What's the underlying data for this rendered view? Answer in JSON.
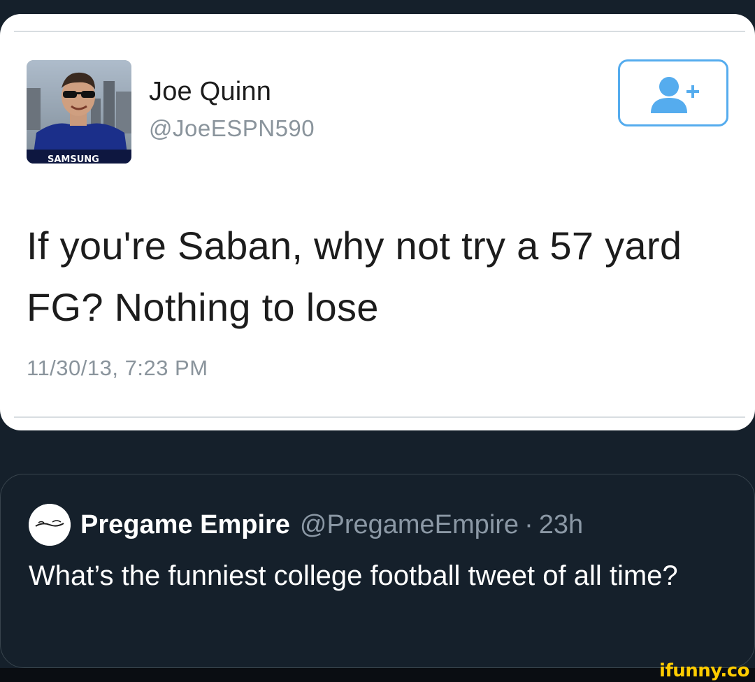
{
  "tweet": {
    "name": "Joe Quinn",
    "handle": "@JoeESPN590",
    "text": "If you're Saban, why not try a 57 yard FG? Nothing to lose",
    "timestamp": "11/30/13, 7:23 PM",
    "avatar_icon": "profile-photo",
    "avatar_shirt_text": "SAMSUNG",
    "follow_icon": "add-user-icon",
    "accent_color": "#55acee"
  },
  "quote": {
    "name": "Pregame Empire",
    "handle": "@PregameEmpire",
    "separator": "·",
    "time": "23h",
    "text": "What’s the funniest college football tweet of all time?",
    "avatar_icon": "pregame-empire-logo"
  },
  "watermark": {
    "text": "ifunny.co",
    "color": "#ffcc00"
  },
  "theme": {
    "background": "#15202b",
    "secondary_text": "#8b98a5"
  }
}
